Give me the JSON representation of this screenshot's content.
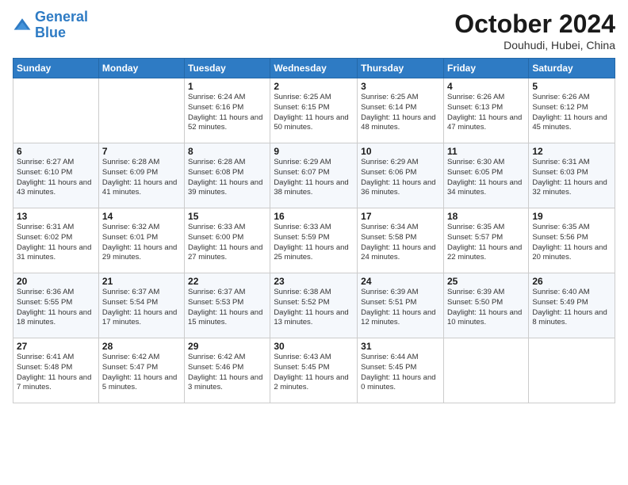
{
  "logo": {
    "line1": "General",
    "line2": "Blue"
  },
  "title": "October 2024",
  "subtitle": "Douhudi, Hubei, China",
  "days_header": [
    "Sunday",
    "Monday",
    "Tuesday",
    "Wednesday",
    "Thursday",
    "Friday",
    "Saturday"
  ],
  "weeks": [
    [
      {
        "day": "",
        "info": ""
      },
      {
        "day": "",
        "info": ""
      },
      {
        "day": "1",
        "info": "Sunrise: 6:24 AM\nSunset: 6:16 PM\nDaylight: 11 hours and 52 minutes."
      },
      {
        "day": "2",
        "info": "Sunrise: 6:25 AM\nSunset: 6:15 PM\nDaylight: 11 hours and 50 minutes."
      },
      {
        "day": "3",
        "info": "Sunrise: 6:25 AM\nSunset: 6:14 PM\nDaylight: 11 hours and 48 minutes."
      },
      {
        "day": "4",
        "info": "Sunrise: 6:26 AM\nSunset: 6:13 PM\nDaylight: 11 hours and 47 minutes."
      },
      {
        "day": "5",
        "info": "Sunrise: 6:26 AM\nSunset: 6:12 PM\nDaylight: 11 hours and 45 minutes."
      }
    ],
    [
      {
        "day": "6",
        "info": "Sunrise: 6:27 AM\nSunset: 6:10 PM\nDaylight: 11 hours and 43 minutes."
      },
      {
        "day": "7",
        "info": "Sunrise: 6:28 AM\nSunset: 6:09 PM\nDaylight: 11 hours and 41 minutes."
      },
      {
        "day": "8",
        "info": "Sunrise: 6:28 AM\nSunset: 6:08 PM\nDaylight: 11 hours and 39 minutes."
      },
      {
        "day": "9",
        "info": "Sunrise: 6:29 AM\nSunset: 6:07 PM\nDaylight: 11 hours and 38 minutes."
      },
      {
        "day": "10",
        "info": "Sunrise: 6:29 AM\nSunset: 6:06 PM\nDaylight: 11 hours and 36 minutes."
      },
      {
        "day": "11",
        "info": "Sunrise: 6:30 AM\nSunset: 6:05 PM\nDaylight: 11 hours and 34 minutes."
      },
      {
        "day": "12",
        "info": "Sunrise: 6:31 AM\nSunset: 6:03 PM\nDaylight: 11 hours and 32 minutes."
      }
    ],
    [
      {
        "day": "13",
        "info": "Sunrise: 6:31 AM\nSunset: 6:02 PM\nDaylight: 11 hours and 31 minutes."
      },
      {
        "day": "14",
        "info": "Sunrise: 6:32 AM\nSunset: 6:01 PM\nDaylight: 11 hours and 29 minutes."
      },
      {
        "day": "15",
        "info": "Sunrise: 6:33 AM\nSunset: 6:00 PM\nDaylight: 11 hours and 27 minutes."
      },
      {
        "day": "16",
        "info": "Sunrise: 6:33 AM\nSunset: 5:59 PM\nDaylight: 11 hours and 25 minutes."
      },
      {
        "day": "17",
        "info": "Sunrise: 6:34 AM\nSunset: 5:58 PM\nDaylight: 11 hours and 24 minutes."
      },
      {
        "day": "18",
        "info": "Sunrise: 6:35 AM\nSunset: 5:57 PM\nDaylight: 11 hours and 22 minutes."
      },
      {
        "day": "19",
        "info": "Sunrise: 6:35 AM\nSunset: 5:56 PM\nDaylight: 11 hours and 20 minutes."
      }
    ],
    [
      {
        "day": "20",
        "info": "Sunrise: 6:36 AM\nSunset: 5:55 PM\nDaylight: 11 hours and 18 minutes."
      },
      {
        "day": "21",
        "info": "Sunrise: 6:37 AM\nSunset: 5:54 PM\nDaylight: 11 hours and 17 minutes."
      },
      {
        "day": "22",
        "info": "Sunrise: 6:37 AM\nSunset: 5:53 PM\nDaylight: 11 hours and 15 minutes."
      },
      {
        "day": "23",
        "info": "Sunrise: 6:38 AM\nSunset: 5:52 PM\nDaylight: 11 hours and 13 minutes."
      },
      {
        "day": "24",
        "info": "Sunrise: 6:39 AM\nSunset: 5:51 PM\nDaylight: 11 hours and 12 minutes."
      },
      {
        "day": "25",
        "info": "Sunrise: 6:39 AM\nSunset: 5:50 PM\nDaylight: 11 hours and 10 minutes."
      },
      {
        "day": "26",
        "info": "Sunrise: 6:40 AM\nSunset: 5:49 PM\nDaylight: 11 hours and 8 minutes."
      }
    ],
    [
      {
        "day": "27",
        "info": "Sunrise: 6:41 AM\nSunset: 5:48 PM\nDaylight: 11 hours and 7 minutes."
      },
      {
        "day": "28",
        "info": "Sunrise: 6:42 AM\nSunset: 5:47 PM\nDaylight: 11 hours and 5 minutes."
      },
      {
        "day": "29",
        "info": "Sunrise: 6:42 AM\nSunset: 5:46 PM\nDaylight: 11 hours and 3 minutes."
      },
      {
        "day": "30",
        "info": "Sunrise: 6:43 AM\nSunset: 5:45 PM\nDaylight: 11 hours and 2 minutes."
      },
      {
        "day": "31",
        "info": "Sunrise: 6:44 AM\nSunset: 5:45 PM\nDaylight: 11 hours and 0 minutes."
      },
      {
        "day": "",
        "info": ""
      },
      {
        "day": "",
        "info": ""
      }
    ]
  ]
}
